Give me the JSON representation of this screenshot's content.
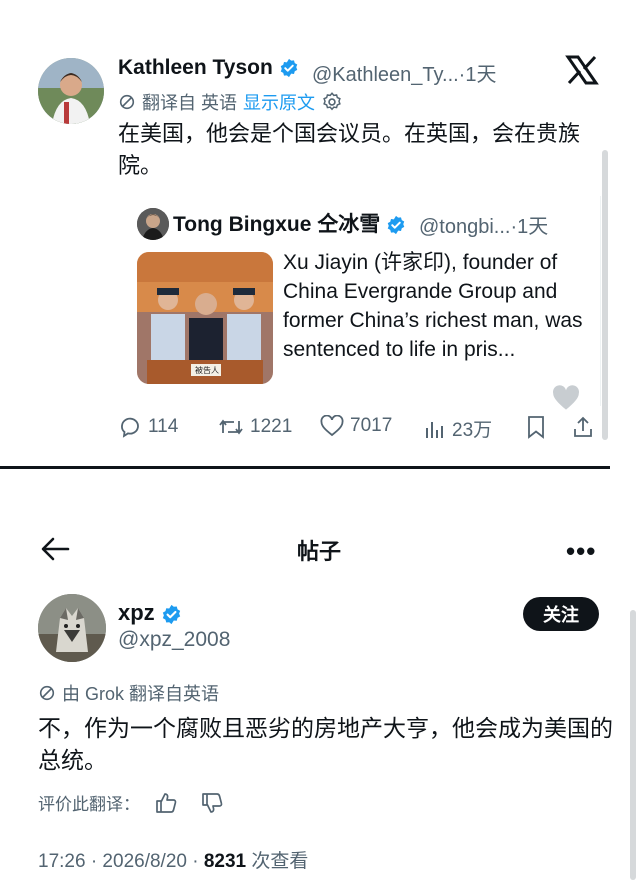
{
  "top_post": {
    "author_name": "Kathleen Tyson",
    "handle_time": "@Kathleen_Ty...·1天",
    "translate_label": "翻译自 英语",
    "show_original": "显示原文",
    "text": "在美国，他会是个国会议员。在英国，会在贵族院。",
    "quote": {
      "author_name": "Tong Bingxue 仝冰雪",
      "handle_time": "@tongbi...·1天",
      "text": "Xu Jiayin (许家印), founder of China Evergrande Group and former China’s richest man, was sentenced to life in pris...",
      "image_caption": "被告人"
    },
    "actions": {
      "replies": "114",
      "reposts": "1221",
      "likes": "7017",
      "views": "23万"
    }
  },
  "post_page": {
    "title": "帖子",
    "more": "•••",
    "author_name": "xpz",
    "handle": "@xpz_2008",
    "follow_label": "关注",
    "grok_translate": "由 Grok 翻译自英语",
    "text": "不，作为一个腐败且恶劣的房地产大亨，他会成为美国的总统。",
    "rate_label": "评价此翻译：",
    "timestamp": "17:26 · 2026/8/20 · ",
    "views_count": "8231",
    "views_label": " 次查看"
  },
  "colors": {
    "verified": "#1d9bf0",
    "link": "#1d9bf0",
    "muted": "#536471",
    "text": "#0f1419"
  }
}
